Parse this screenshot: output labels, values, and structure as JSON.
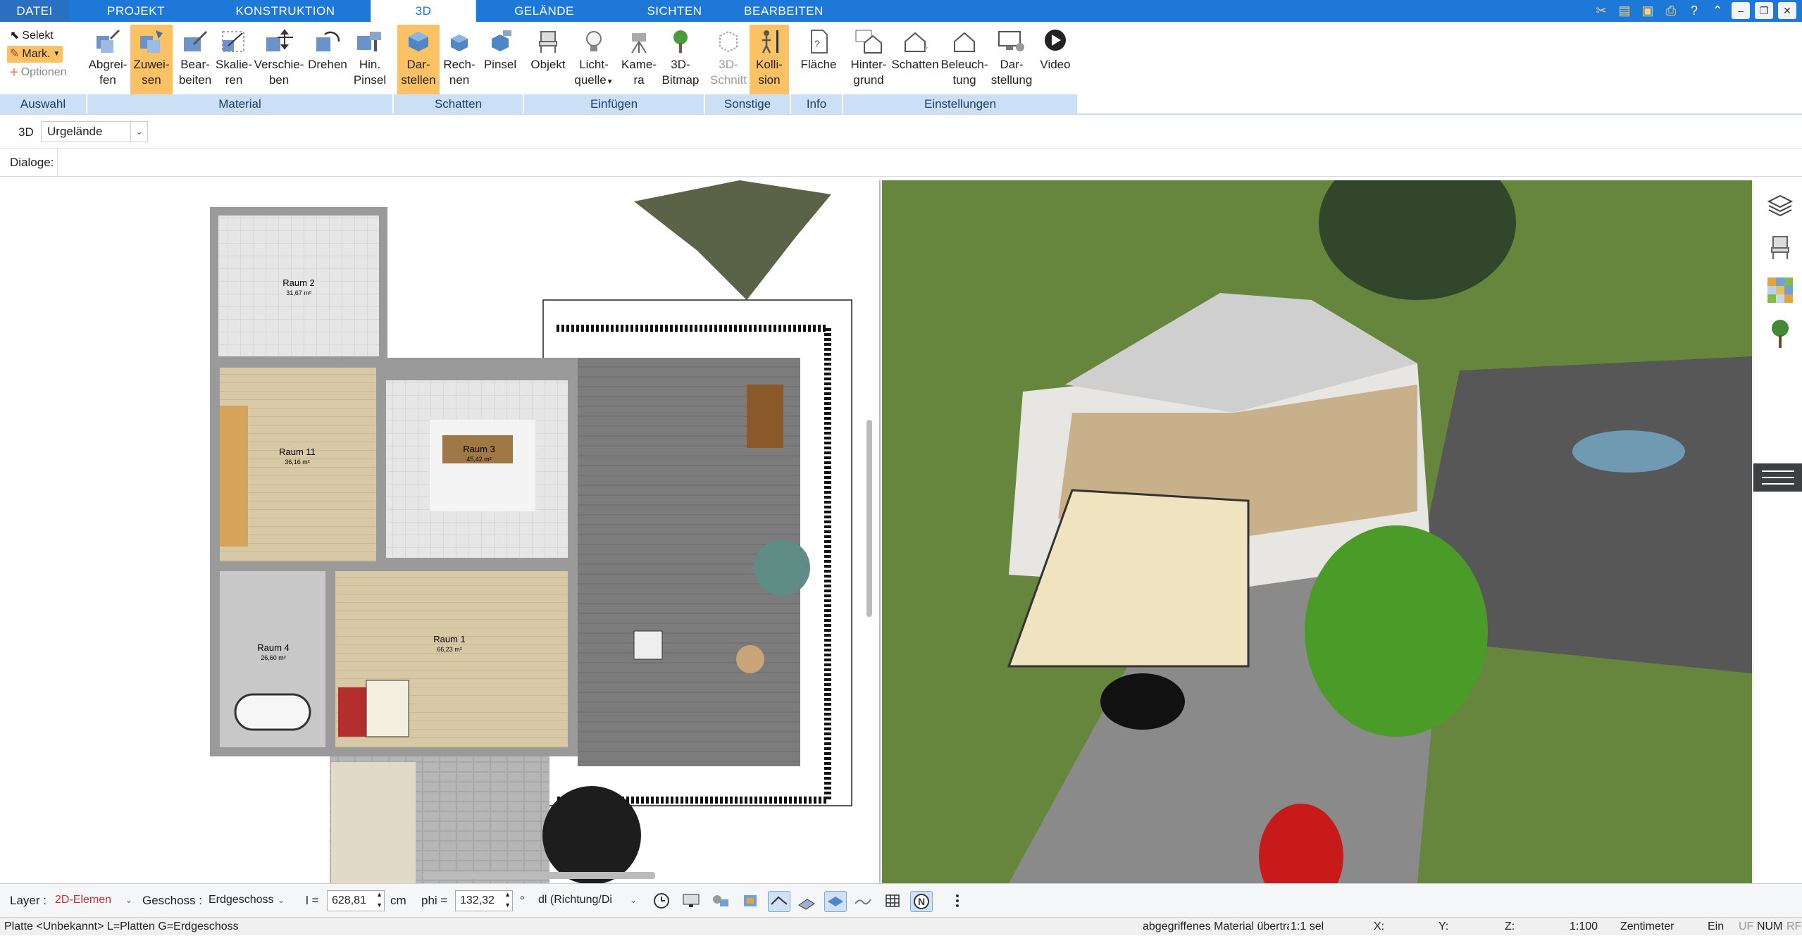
{
  "tabs": [
    "DATEI",
    "PROJEKT",
    "KONSTRUKTION",
    "3D",
    "GELÄNDE",
    "SICHTEN",
    "BEARBEITEN"
  ],
  "active_tab": "3D",
  "select_group": {
    "selekt": "Selekt",
    "mark": "Mark.",
    "optionen": "Optionen",
    "group": "Auswahl"
  },
  "ribbon": {
    "material": {
      "group": "Material",
      "buttons": [
        [
          "Abgrei-",
          "fen"
        ],
        [
          "Zuwei-",
          "sen"
        ],
        [
          "Bear-",
          "beiten"
        ],
        [
          "Skalie-",
          "ren"
        ],
        [
          "Verschie-",
          "ben"
        ],
        [
          "Drehen",
          ""
        ],
        [
          "Hin.",
          "Pinsel"
        ]
      ]
    },
    "schatten": {
      "group": "Schatten",
      "buttons": [
        [
          "Dar-",
          "stellen"
        ],
        [
          "Rech-",
          "nen"
        ],
        [
          "Pinsel",
          ""
        ]
      ]
    },
    "einfuegen": {
      "group": "Einfügen",
      "buttons": [
        [
          "Objekt",
          ""
        ],
        [
          "Licht-",
          "quelle"
        ],
        [
          "Kame-",
          "ra"
        ],
        [
          "3D-",
          "Bitmap"
        ]
      ]
    },
    "sonstige": {
      "group": "Sonstige",
      "buttons": [
        [
          "3D-",
          "Schnitt"
        ],
        [
          "Kolli-",
          "sion"
        ]
      ]
    },
    "info": {
      "group": "Info",
      "buttons": [
        [
          "Fläche",
          ""
        ]
      ]
    },
    "einstellungen": {
      "group": "Einstellungen",
      "buttons": [
        [
          "Hinter-",
          "grund"
        ],
        [
          "Schatten",
          ""
        ],
        [
          "Beleuch-",
          "tung"
        ],
        [
          "Dar-",
          "stellung"
        ],
        [
          "Video",
          ""
        ]
      ]
    }
  },
  "context": {
    "label": "3D",
    "dropdown": "Urgelände"
  },
  "dialoge_label": "Dialoge:",
  "plan_rooms": [
    {
      "name": "Raum 2",
      "area": "31,67 m²"
    },
    {
      "name": "Raum 11",
      "area": "36,16 m²"
    },
    {
      "name": "Raum 3",
      "area": "45,42 m²"
    },
    {
      "name": "Raum 4",
      "area": "26,60 m²"
    },
    {
      "name": "Raum 1",
      "area": "66,23 m²"
    }
  ],
  "bottom": {
    "layer_label": "Layer :",
    "layer_value": "2D-Elemen",
    "geschoss_label": "Geschoss :",
    "geschoss_value": "Erdgeschoss",
    "l_label": "l =",
    "l_value": "628,81",
    "l_unit": "cm",
    "phi_label": "phi =",
    "phi_value": "132,32",
    "phi_unit": "°",
    "dl_value": "dl (Richtung/Di"
  },
  "status": {
    "left": "Platte <Unbekannt> L=Platten G=Erdgeschoss",
    "msg": "abgegriffenes Material übertrage",
    "scale_short": "1:1 sel",
    "x": "X:",
    "y": "Y:",
    "z": "Z:",
    "scale": "1:100",
    "unit": "Zentimeter",
    "mode": "Ein",
    "uf": "UF",
    "num": "NUM",
    "rf": "RF"
  },
  "colors": {
    "accent": "#1e78d7",
    "selected": "#fbc165",
    "group_bg": "#cbe0f7"
  }
}
